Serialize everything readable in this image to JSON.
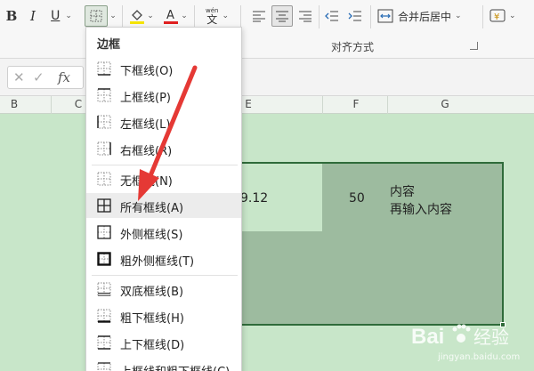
{
  "ribbon": {
    "bold_label": "B",
    "italic_label": "I",
    "underline_label": "U",
    "phonetic_top": "wén",
    "phonetic_bottom": "文",
    "merge_label": "合并后居中",
    "group_label": "对齐方式",
    "font_color": "#e02020",
    "fill_color": "#f5e400",
    "currency_symbol": "¥"
  },
  "formula_bar": {
    "fx_label": "fx"
  },
  "columns": [
    "B",
    "C",
    "E",
    "F",
    "G"
  ],
  "cells": {
    "e_value": "9.12",
    "f_value": "50",
    "g_line1": "内容",
    "g_line2": "再输入内容"
  },
  "border_menu": {
    "title": "边框",
    "items": [
      {
        "label": "下框线(O)",
        "icon": "bottom-border-icon"
      },
      {
        "label": "上框线(P)",
        "icon": "top-border-icon"
      },
      {
        "label": "左框线(L)",
        "icon": "left-border-icon"
      },
      {
        "label": "右框线(R)",
        "icon": "right-border-icon"
      },
      {
        "label": "无框线(N)",
        "icon": "no-border-icon"
      },
      {
        "label": "所有框线(A)",
        "icon": "all-borders-icon",
        "highlighted": true
      },
      {
        "label": "外侧框线(S)",
        "icon": "outside-borders-icon"
      },
      {
        "label": "粗外侧框线(T)",
        "icon": "thick-outside-borders-icon"
      },
      {
        "label": "双底框线(B)",
        "icon": "double-bottom-border-icon"
      },
      {
        "label": "粗下框线(H)",
        "icon": "thick-bottom-border-icon"
      },
      {
        "label": "上下框线(D)",
        "icon": "top-bottom-border-icon"
      },
      {
        "label": "上框线和粗下框线(C)",
        "icon": "top-thick-bottom-border-icon"
      }
    ]
  },
  "watermark": {
    "brand": "Bai",
    "suffix": "经验",
    "url": "jingyan.baidu.com"
  },
  "colors": {
    "sheet_bg": "#c8e6c9",
    "selection_fill": "#9dbb9f",
    "selection_border": "#2f6b3a",
    "arrow": "#e53935"
  }
}
